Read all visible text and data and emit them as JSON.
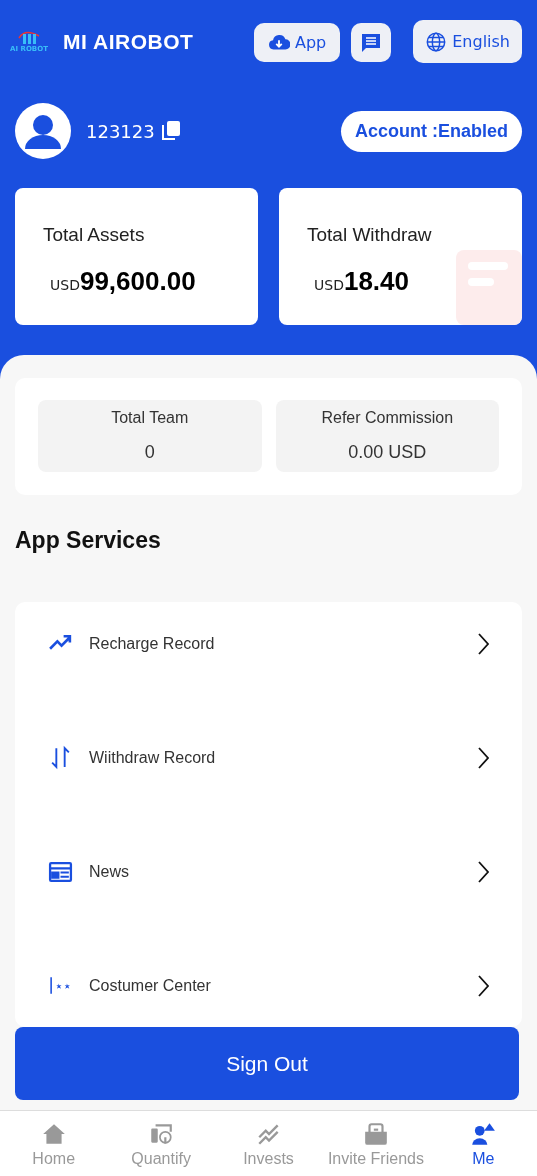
{
  "header": {
    "brand": "MI AIROBOT",
    "logo_text": "AI ROBOT",
    "app_button": "App",
    "language_button": "English"
  },
  "profile": {
    "user_id": "123123",
    "account_status": "Account :Enabled"
  },
  "summary_cards": [
    {
      "kind": "assets",
      "title": "Total Assets",
      "currency": "USD",
      "amount": "99,600.00"
    },
    {
      "kind": "withdraw",
      "title": "Total Withdraw",
      "currency": "USD",
      "amount": "18.40"
    }
  ],
  "team_stats": [
    {
      "label": "Total Team",
      "value": "0"
    },
    {
      "label": "Refer Commission",
      "value": "0.00 USD"
    }
  ],
  "services": {
    "title": "App Services",
    "items": [
      {
        "kind": "recharge",
        "label": "Recharge Record"
      },
      {
        "kind": "withdraw",
        "label": "Wiithdraw Record"
      },
      {
        "kind": "news",
        "label": "News"
      },
      {
        "kind": "support",
        "label": "Costumer Center"
      }
    ]
  },
  "sign_out": "Sign Out",
  "bottom_nav": [
    {
      "kind": "home",
      "label": "Home",
      "selected": false
    },
    {
      "kind": "quantify",
      "label": "Quantify",
      "selected": false
    },
    {
      "kind": "invests",
      "label": "Invests",
      "selected": false
    },
    {
      "kind": "invite",
      "label": "Invite Friends",
      "selected": false
    },
    {
      "kind": "me",
      "label": "Me",
      "selected": true
    }
  ]
}
